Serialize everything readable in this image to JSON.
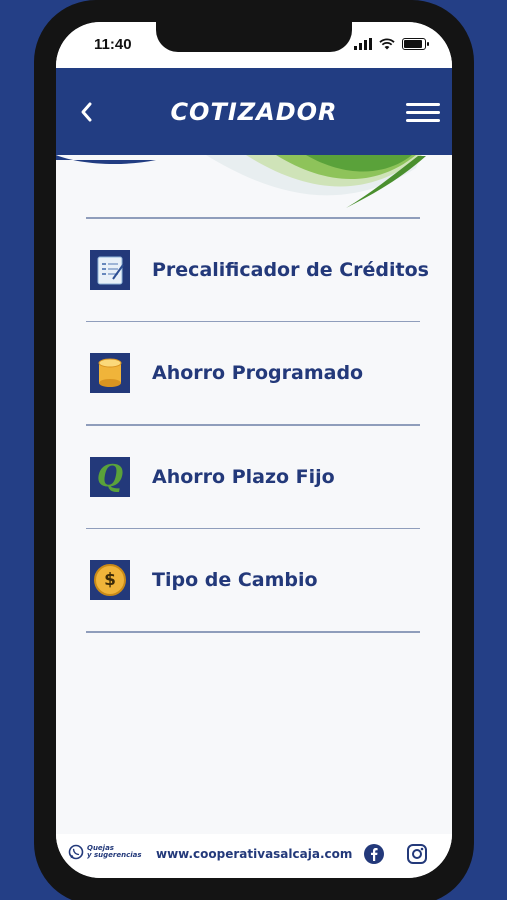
{
  "status_bar": {
    "time": "11:40"
  },
  "header": {
    "title": "COTIZADOR",
    "back_icon": "chevron-left-icon",
    "menu_icon": "hamburger-menu-icon"
  },
  "colors": {
    "background": "#243f86",
    "header": "#223d82",
    "text_primary": "#23397a",
    "accent_green": "#5aa23a",
    "divider": "#8f9dbb",
    "coin": "#f0b43a"
  },
  "menu": {
    "items": [
      {
        "label": "Precalificador de Créditos",
        "icon": "clipboard-checklist-icon"
      },
      {
        "label": "Ahorro Programado",
        "icon": "coin-stack-icon"
      },
      {
        "label": "Ahorro Plazo Fijo",
        "icon": "letter-q-icon",
        "icon_text": "Q"
      },
      {
        "label": "Tipo de Cambio",
        "icon": "dollar-coin-icon",
        "icon_text": "$"
      }
    ]
  },
  "footer": {
    "quejas_line1": "Quejas",
    "quejas_line2": "y sugerencias",
    "website": "www.cooperativasalcaja.com",
    "whatsapp_icon": "whatsapp-icon",
    "facebook_icon": "facebook-icon",
    "instagram_icon": "instagram-icon"
  }
}
